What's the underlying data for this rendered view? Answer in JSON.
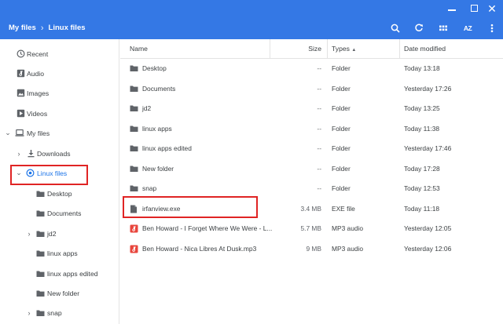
{
  "breadcrumb": {
    "root": "My files",
    "separator": "›",
    "current": "Linux files"
  },
  "toolbar": {
    "sort_label": "AZ"
  },
  "sidebar": {
    "items": [
      {
        "label": "Recent",
        "icon": "clock-icon"
      },
      {
        "label": "Audio",
        "icon": "audio-icon"
      },
      {
        "label": "Images",
        "icon": "image-icon"
      },
      {
        "label": "Videos",
        "icon": "video-icon"
      },
      {
        "label": "My files",
        "icon": "laptop-icon",
        "arrow": "⌄"
      },
      {
        "label": "Downloads",
        "icon": "download-icon",
        "arrow": "›"
      },
      {
        "label": "Linux files",
        "icon": "linux-icon",
        "arrow": "⌄"
      },
      {
        "label": "Desktop",
        "icon": "folder-icon"
      },
      {
        "label": "Documents",
        "icon": "folder-icon"
      },
      {
        "label": "jd2",
        "icon": "folder-icon",
        "arrow": "›"
      },
      {
        "label": "linux apps",
        "icon": "folder-icon"
      },
      {
        "label": "linux apps edited",
        "icon": "folder-icon"
      },
      {
        "label": "New folder",
        "icon": "folder-icon"
      },
      {
        "label": "snap",
        "icon": "folder-icon",
        "arrow": "›"
      }
    ]
  },
  "columns": {
    "name": "Name",
    "size": "Size",
    "type": "Types",
    "type_sort": "▲",
    "date": "Date modified"
  },
  "files": [
    {
      "name": "Desktop",
      "size": "--",
      "type": "Folder",
      "date": "Today 13:18",
      "kind": "folder"
    },
    {
      "name": "Documents",
      "size": "--",
      "type": "Folder",
      "date": "Yesterday 17:26",
      "kind": "folder"
    },
    {
      "name": "jd2",
      "size": "--",
      "type": "Folder",
      "date": "Today 13:25",
      "kind": "folder"
    },
    {
      "name": "linux apps",
      "size": "--",
      "type": "Folder",
      "date": "Today 11:38",
      "kind": "folder"
    },
    {
      "name": "linux apps edited",
      "size": "--",
      "type": "Folder",
      "date": "Yesterday 17:46",
      "kind": "folder"
    },
    {
      "name": "New folder",
      "size": "--",
      "type": "Folder",
      "date": "Today 17:28",
      "kind": "folder"
    },
    {
      "name": "snap",
      "size": "--",
      "type": "Folder",
      "date": "Today 12:53",
      "kind": "folder"
    },
    {
      "name": "irfanview.exe",
      "size": "3.4 MB",
      "type": "EXE file",
      "date": "Today 11:18",
      "kind": "file"
    },
    {
      "name": "Ben Howard - I Forget Where We Were - L...",
      "size": "5.7 MB",
      "type": "MP3 audio",
      "date": "Yesterday 12:05",
      "kind": "audio"
    },
    {
      "name": "Ben Howard - Nica Libres At Dusk.mp3",
      "size": "9 MB",
      "type": "MP3 audio",
      "date": "Yesterday 12:06",
      "kind": "audio"
    }
  ],
  "colors": {
    "accent": "#3478e5",
    "highlight": "#e02424",
    "audio": "#e8453c",
    "active": "#1a73e8"
  }
}
